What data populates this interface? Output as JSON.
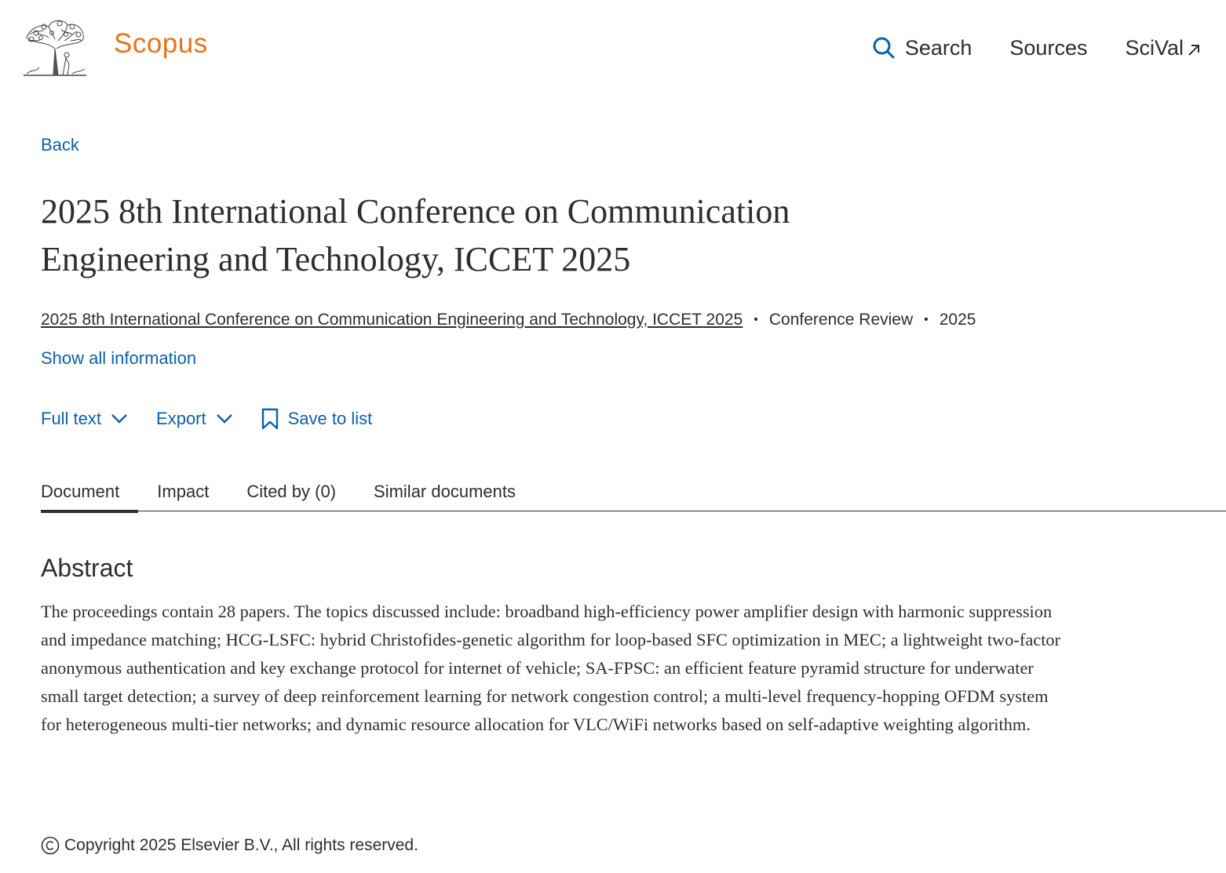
{
  "header": {
    "brand": "Scopus",
    "nav": {
      "search": "Search",
      "sources": "Sources",
      "scival": "SciVal"
    }
  },
  "main": {
    "back_label": "Back",
    "title": "2025 8th International Conference on Communication Engineering and Technology, ICCET 2025",
    "meta": {
      "source": "2025 8th International Conference on Communication Engineering and Technology, ICCET 2025",
      "doc_type": "Conference Review",
      "year": "2025"
    },
    "show_all_label": "Show all information",
    "actions": {
      "full_text": "Full text",
      "export": "Export",
      "save_to_list": "Save to list"
    },
    "tabs": [
      {
        "label": "Document",
        "active": true
      },
      {
        "label": "Impact",
        "active": false
      },
      {
        "label": "Cited by (0)",
        "active": false
      },
      {
        "label": "Similar documents",
        "active": false
      }
    ],
    "abstract": {
      "heading": "Abstract",
      "text": "The proceedings contain 28 papers. The topics discussed include: broadband high-efficiency power amplifier design with harmonic suppression and impedance matching; HCG-LSFC: hybrid Christofides-genetic algorithm for loop-based SFC optimization in MEC; a lightweight two-factor anonymous authentication and key exchange protocol for internet of vehicle; SA-FPSC: an efficient feature pyramid structure for underwater small target detection; a survey of deep reinforcement learning for network congestion control; a multi-level frequency-hopping OFDM system for heterogeneous multi-tier networks; and dynamic resource allocation for VLC/WiFi networks based on self-adaptive weighting algorithm."
    },
    "copyright": "Copyright 2025 Elsevier B.V., All rights reserved."
  },
  "colors": {
    "brand_orange": "#e9711c",
    "link_blue": "#0c5fab",
    "text": "#2e2e2e"
  },
  "icons": {
    "logo": "elsevier-tree-logo",
    "search": "search-icon",
    "scival_external": "external-link-icon",
    "chevron": "chevron-down-icon",
    "bookmark": "bookmark-icon",
    "copyright": "copyright-icon"
  }
}
